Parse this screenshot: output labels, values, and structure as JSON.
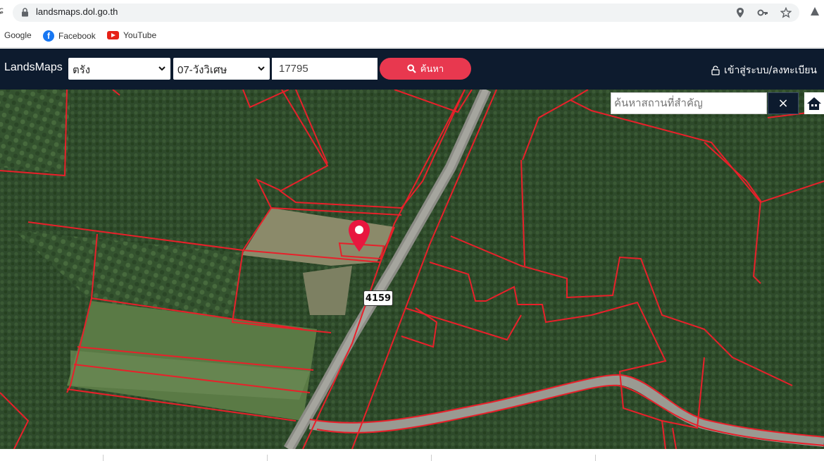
{
  "browser": {
    "url": "landsmaps.dol.go.th",
    "bookmarks": [
      {
        "label": "Google"
      },
      {
        "label": "Facebook"
      },
      {
        "label": "YouTube"
      }
    ]
  },
  "app": {
    "logo": "LandsMaps",
    "province": "ตรัง",
    "district": "07-วังวิเศษ",
    "parcel_number": "17795",
    "search_button": "ค้นหา",
    "login": "เข้าสู่ระบบ/ลงทะเบียน"
  },
  "map": {
    "place_search_placeholder": "ค้นหาสถานที่สำคัญ",
    "close_symbol": "×",
    "road_number": "4159",
    "parcel_line_color": "#e8202a",
    "pin_color": "#e8173f"
  }
}
